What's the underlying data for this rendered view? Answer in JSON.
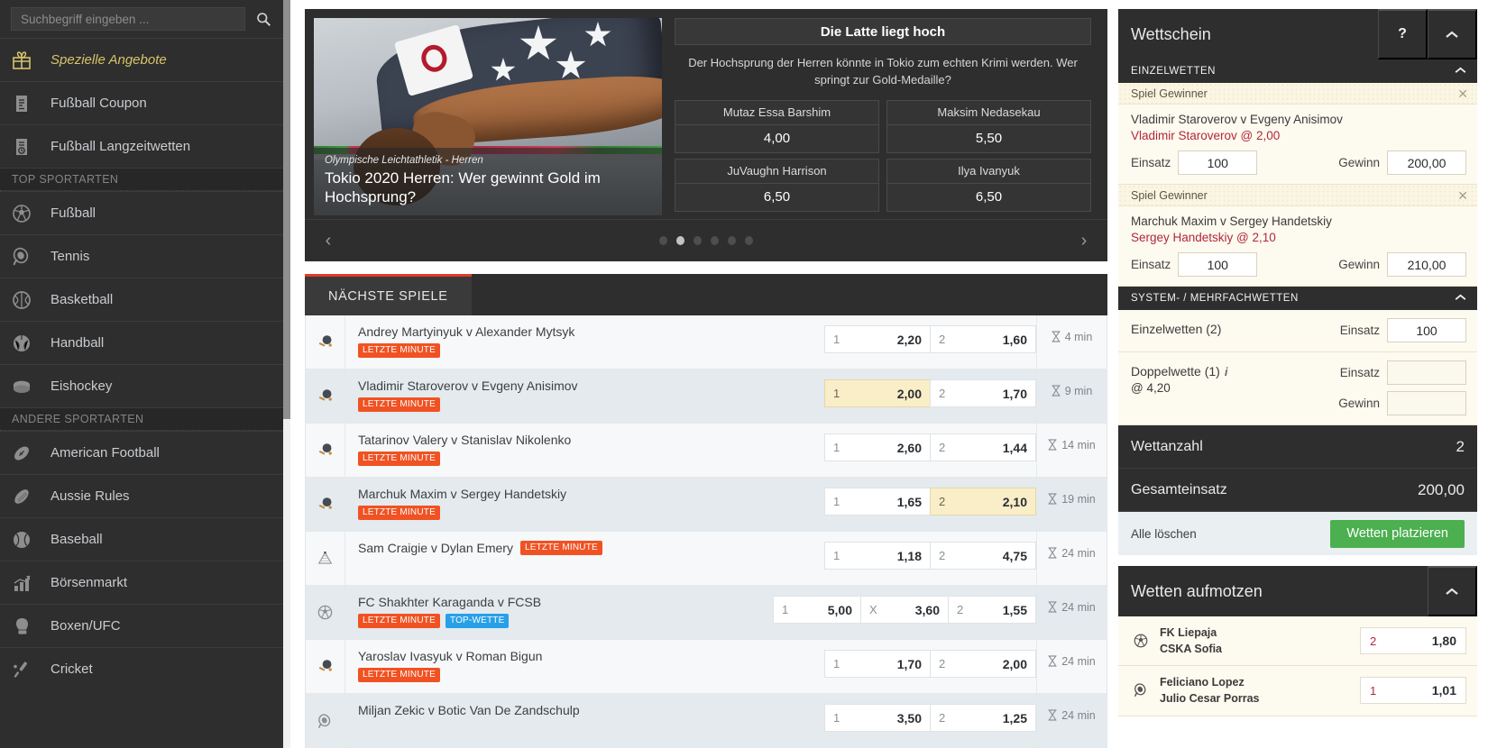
{
  "search": {
    "placeholder": "Suchbegriff eingeben ...",
    "icon": "search-icon"
  },
  "sidebar": {
    "items": [
      {
        "label": "Spezielle Angebote",
        "icon": "gift-icon",
        "type": "special"
      },
      {
        "label": "Fußball Coupon",
        "icon": "coupon-icon",
        "type": "item"
      },
      {
        "label": "Fußball Langzeitwetten",
        "icon": "coupon-clock-icon",
        "type": "item"
      },
      {
        "label": "TOP SPORTARTEN",
        "type": "group"
      },
      {
        "label": "Fußball",
        "icon": "soccer-ball-icon",
        "type": "item"
      },
      {
        "label": "Tennis",
        "icon": "tennis-racket-icon",
        "type": "item"
      },
      {
        "label": "Basketball",
        "icon": "basketball-icon",
        "type": "item"
      },
      {
        "label": "Handball",
        "icon": "handball-icon",
        "type": "item"
      },
      {
        "label": "Eishockey",
        "icon": "hockey-puck-icon",
        "type": "item"
      },
      {
        "label": "ANDERE SPORTARTEN",
        "type": "group"
      },
      {
        "label": "American Football",
        "icon": "american-football-icon",
        "type": "item"
      },
      {
        "label": "Aussie Rules",
        "icon": "aussie-rules-ball-icon",
        "type": "item"
      },
      {
        "label": "Baseball",
        "icon": "baseball-icon",
        "type": "item"
      },
      {
        "label": "Börsenmarkt",
        "icon": "bar-chart-icon",
        "type": "item"
      },
      {
        "label": "Boxen/UFC",
        "icon": "boxing-glove-icon",
        "type": "item"
      },
      {
        "label": "Cricket",
        "icon": "cricket-bat-icon",
        "type": "item"
      }
    ]
  },
  "promo": {
    "image_kicker": "Olympische Leichtathletik - Herren",
    "image_title": "Tokio 2020 Herren: Wer gewinnt Gold im Hochsprung?",
    "headline": "Die Latte liegt hoch",
    "subtext": "Der Hochsprung der Herren könnte in Tokio zum echten Krimi werden. Wer springt zur Gold-Medaille?",
    "selections": [
      {
        "name": "Mutaz Essa Barshim",
        "odds": "4,00"
      },
      {
        "name": "Maksim Nedasekau",
        "odds": "5,50"
      },
      {
        "name": "JuVaughn Harrison",
        "odds": "6,50"
      },
      {
        "name": "Ilya Ivanyuk",
        "odds": "6,50"
      }
    ],
    "prev_arrow": "‹",
    "next_arrow": "›",
    "dots_total": 6,
    "dots_active": 2
  },
  "games": {
    "tab_label": "NÄCHSTE SPIELE",
    "rows": [
      {
        "icon": "table-tennis-icon",
        "teams": "Andrey Martyinyuk v Alexander Mytsyk",
        "tags": [
          {
            "text": "LETZTE MINUTE",
            "kind": "lm"
          }
        ],
        "tags_inline": false,
        "markets": [
          {
            "key": "1",
            "value": "2,20",
            "selected": false
          },
          {
            "key": "2",
            "value": "1,60",
            "selected": false
          }
        ],
        "time": "4 min"
      },
      {
        "icon": "table-tennis-icon",
        "teams": "Vladimir Staroverov v Evgeny Anisimov",
        "tags": [
          {
            "text": "LETZTE MINUTE",
            "kind": "lm"
          }
        ],
        "tags_inline": false,
        "markets": [
          {
            "key": "1",
            "value": "2,00",
            "selected": true
          },
          {
            "key": "2",
            "value": "1,70",
            "selected": false
          }
        ],
        "time": "9 min"
      },
      {
        "icon": "table-tennis-icon",
        "teams": "Tatarinov Valery v Stanislav Nikolenko",
        "tags": [
          {
            "text": "LETZTE MINUTE",
            "kind": "lm"
          }
        ],
        "tags_inline": false,
        "markets": [
          {
            "key": "1",
            "value": "2,60",
            "selected": false
          },
          {
            "key": "2",
            "value": "1,44",
            "selected": false
          }
        ],
        "time": "14 min"
      },
      {
        "icon": "table-tennis-icon",
        "teams": "Marchuk Maxim v Sergey Handetskiy",
        "tags": [
          {
            "text": "LETZTE MINUTE",
            "kind": "lm"
          }
        ],
        "tags_inline": false,
        "markets": [
          {
            "key": "1",
            "value": "1,65",
            "selected": false
          },
          {
            "key": "2",
            "value": "2,10",
            "selected": true
          }
        ],
        "time": "19 min"
      },
      {
        "icon": "darts-icon",
        "teams": "Sam Craigie v Dylan Emery",
        "tags": [
          {
            "text": "LETZTE MINUTE",
            "kind": "lm"
          }
        ],
        "tags_inline": true,
        "markets": [
          {
            "key": "1",
            "value": "1,18",
            "selected": false
          },
          {
            "key": "2",
            "value": "4,75",
            "selected": false
          }
        ],
        "time": "24 min"
      },
      {
        "icon": "soccer-ball-icon",
        "teams": "FC Shakhter Karaganda v FCSB",
        "tags": [
          {
            "text": "LETZTE MINUTE",
            "kind": "lm"
          },
          {
            "text": "TOP-WETTE",
            "kind": "top"
          }
        ],
        "tags_inline": false,
        "markets": [
          {
            "key": "1",
            "value": "5,00",
            "selected": false
          },
          {
            "key": "X",
            "value": "3,60",
            "selected": false
          },
          {
            "key": "2",
            "value": "1,55",
            "selected": false
          }
        ],
        "time": "24 min"
      },
      {
        "icon": "table-tennis-icon",
        "teams": "Yaroslav Ivasyuk v Roman Bigun",
        "tags": [
          {
            "text": "LETZTE MINUTE",
            "kind": "lm"
          }
        ],
        "tags_inline": false,
        "markets": [
          {
            "key": "1",
            "value": "1,70",
            "selected": false
          },
          {
            "key": "2",
            "value": "2,00",
            "selected": false
          }
        ],
        "time": "24 min"
      },
      {
        "icon": "tennis-racket-icon",
        "teams": "Miljan Zekic v Botic Van De Zandschulp",
        "tags": [],
        "tags_inline": false,
        "markets": [
          {
            "key": "1",
            "value": "3,50",
            "selected": false
          },
          {
            "key": "2",
            "value": "1,25",
            "selected": false
          }
        ],
        "time": "24 min"
      }
    ]
  },
  "betslip": {
    "title": "Wettschein",
    "help_label": "?",
    "collapse_icon": "chevron-up-icon",
    "singles_header": "EINZELWETTEN",
    "items": [
      {
        "market": "Spiel Gewinner",
        "match": "Vladimir Staroverov v Evgeny Anisimov",
        "pick": "Vladimir Staroverov @ 2,00",
        "stake_label": "Einsatz",
        "stake": "100",
        "win_label": "Gewinn",
        "win": "200,00",
        "remove_icon": "close-icon"
      },
      {
        "market": "Spiel Gewinner",
        "match": "Marchuk Maxim v Sergey Handetskiy",
        "pick": "Sergey Handetskiy @ 2,10",
        "stake_label": "Einsatz",
        "stake": "100",
        "win_label": "Gewinn",
        "win": "210,00",
        "remove_icon": "close-icon"
      }
    ],
    "multiples_header": "SYSTEM- / MEHRFACHWETTEN",
    "multiples": [
      {
        "name": "Einzelwetten (2)",
        "odds_line": "",
        "has_info": false,
        "stake_label": "Einsatz",
        "stake": "100",
        "win_label": "",
        "win": ""
      },
      {
        "name": "Doppelwette (1)",
        "odds_line": "@ 4,20",
        "has_info": true,
        "stake_label": "Einsatz",
        "stake": "",
        "win_label": "Gewinn",
        "win": ""
      }
    ],
    "bet_count_label": "Wettanzahl",
    "bet_count": "2",
    "total_stake_label": "Gesamteinsatz",
    "total_stake": "200,00",
    "clear_all": "Alle löschen",
    "place_bets": "Wetten platzieren"
  },
  "boost": {
    "title": "Wetten aufmotzen",
    "collapse_icon": "chevron-up-icon",
    "rows": [
      {
        "icon": "soccer-ball-icon",
        "home": "FK Liepaja",
        "away": "CSKA Sofia",
        "key": "2",
        "odds": "1,80"
      },
      {
        "icon": "tennis-racket-icon",
        "home": "Feliciano Lopez",
        "away": "Julio Cesar Porras",
        "key": "1",
        "odds": "1,01"
      }
    ]
  },
  "colors": {
    "accent_red": "#e03a28",
    "tag_orange": "#f05223",
    "tag_blue": "#28a0e8",
    "green": "#4caf50",
    "pick_red": "#b2273a",
    "gold": "#d8c36a"
  }
}
